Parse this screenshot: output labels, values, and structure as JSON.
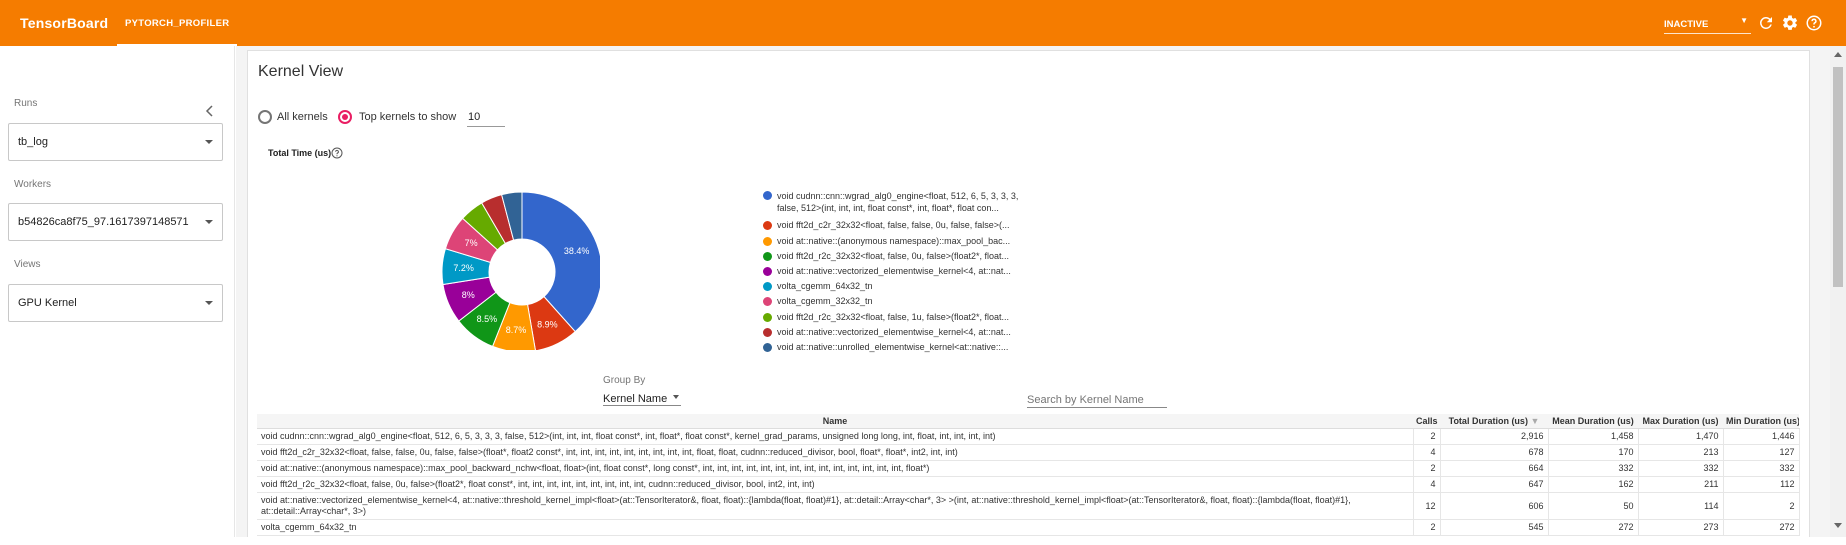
{
  "header": {
    "brand": "TensorBoard",
    "tab": "PYTORCH_PROFILER",
    "status_select": "INACTIVE",
    "icons": [
      "refresh-icon",
      "settings-icon",
      "help-icon"
    ],
    "color": "#f57c00"
  },
  "sidebar": {
    "collapse_icon": "chevron-left-icon",
    "runs_label": "Runs",
    "runs_value": "tb_log",
    "workers_label": "Workers",
    "workers_value": "b54826ca8f75_97.1617397148571",
    "views_label": "Views",
    "views_value": "GPU Kernel"
  },
  "main": {
    "title": "Kernel View",
    "all_kernels_label": "All kernels",
    "top_kernels_label": "Top kernels to show",
    "top_kernels_value": "10",
    "chart_title": "Total Time (us)",
    "groupby_label": "Group By",
    "groupby_value": "Kernel Name",
    "search_placeholder": "Search by Kernel Name"
  },
  "chart_data": {
    "type": "pie",
    "title": "Total Time (us)",
    "donut": true,
    "slices": [
      {
        "label": "void cudnn::cnn::wgrad_alg0_engine<float, 512, 6, 5, 3, 3, 3, false, 512>(int, int, int, float const*, int, float*, float con...",
        "value": 38.4,
        "color": "#3366cc",
        "shown_pct": "38.4%"
      },
      {
        "label": "void fft2d_c2r_32x32<float, false, false, 0u, false, false>(...",
        "value": 8.9,
        "color": "#dc3912",
        "shown_pct": "8.9%"
      },
      {
        "label": "void at::native::(anonymous namespace)::max_pool_bac...",
        "value": 8.7,
        "color": "#ff9900",
        "shown_pct": "8.7%"
      },
      {
        "label": "void fft2d_r2c_32x32<float, false, 0u, false>(float2*, float...",
        "value": 8.5,
        "color": "#109618",
        "shown_pct": "8.5%"
      },
      {
        "label": "void at::native::vectorized_elementwise_kernel<4, at::nat...",
        "value": 8.0,
        "color": "#990099",
        "shown_pct": "8%"
      },
      {
        "label": "volta_cgemm_64x32_tn",
        "value": 7.2,
        "color": "#0099c6",
        "shown_pct": "7.2%"
      },
      {
        "label": "volta_cgemm_32x32_tn",
        "value": 7.0,
        "color": "#dd4477",
        "shown_pct": "7%"
      },
      {
        "label": "void fft2d_r2c_32x32<float, false, 1u, false>(float2*, float...",
        "value": 4.9,
        "color": "#66aa00",
        "shown_pct": ""
      },
      {
        "label": "void at::native::vectorized_elementwise_kernel<4, at::nat...",
        "value": 4.3,
        "color": "#b82e2e",
        "shown_pct": ""
      },
      {
        "label": "void at::native::unrolled_elementwise_kernel<at::native::...",
        "value": 4.1,
        "color": "#316395",
        "shown_pct": ""
      }
    ]
  },
  "table": {
    "headers": [
      "Name",
      "Calls",
      "Total Duration (us)",
      "Mean Duration (us)",
      "Max Duration (us)",
      "Min Duration (us)"
    ],
    "sort_icon": "sort-down-icon",
    "rows": [
      [
        "void cudnn::cnn::wgrad_alg0_engine<float, 512, 6, 5, 3, 3, 3, false, 512>(int, int, int, float const*, int, float*, float const*, kernel_grad_params, unsigned long long, int, float, int, int, int, int)",
        "2",
        "2,916",
        "1,458",
        "1,470",
        "1,446"
      ],
      [
        "void fft2d_c2r_32x32<float, false, false, 0u, false, false>(float*, float2 const*, int, int, int, int, int, int, int, int, int, float, float, cudnn::reduced_divisor, bool, float*, float*, int2, int, int)",
        "4",
        "678",
        "170",
        "213",
        "127"
      ],
      [
        "void at::native::(anonymous namespace)::max_pool_backward_nchw<float, float>(int, float const*, long const*, int, int, int, int, int, int, int, int, int, int, int, int, int, int, float*)",
        "2",
        "664",
        "332",
        "332",
        "332"
      ],
      [
        "void fft2d_r2c_32x32<float, false, 0u, false>(float2*, float const*, int, int, int, int, int, int, int, int, int, cudnn::reduced_divisor, bool, int2, int, int)",
        "4",
        "647",
        "162",
        "211",
        "112"
      ],
      [
        "void at::native::vectorized_elementwise_kernel<4, at::native::threshold_kernel_impl<float>(at::TensorIterator&, float, float)::{lambda(float, float)#1}, at::detail::Array<char*, 3> >(int, at::native::threshold_kernel_impl<float>(at::TensorIterator&, float, float)::{lambda(float, float)#1}, at::detail::Array<char*, 3>)",
        "12",
        "606",
        "50",
        "114",
        "2"
      ],
      [
        "volta_cgemm_64x32_tn",
        "2",
        "545",
        "272",
        "273",
        "272"
      ]
    ]
  }
}
